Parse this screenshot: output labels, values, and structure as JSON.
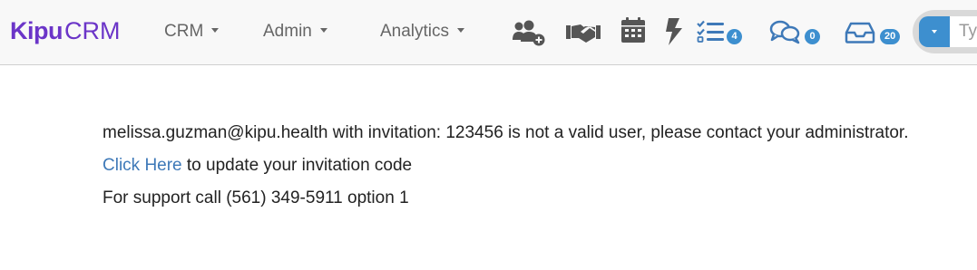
{
  "brand": {
    "part1": "Kipu",
    "part2": "CRM"
  },
  "nav": {
    "menus": [
      {
        "label": "CRM"
      },
      {
        "label": "Admin"
      },
      {
        "label": "Analytics"
      }
    ],
    "icons": [
      {
        "name": "add-user-icon"
      },
      {
        "name": "handshake-icon"
      },
      {
        "name": "calendar-icon"
      },
      {
        "name": "lightning-icon"
      },
      {
        "name": "task-list-icon",
        "badge": "4"
      },
      {
        "name": "comments-icon",
        "badge": "0"
      },
      {
        "name": "inbox-icon",
        "badge": "20"
      }
    ],
    "search": {
      "value": "Ty"
    }
  },
  "message": {
    "error_text": "melissa.guzman@kipu.health with invitation: 123456 is not a valid user, please contact your administrator.",
    "link_text": "Click Here",
    "link_suffix": " to update your invitation code",
    "support_text": "For support call (561) 349-5911 option 1"
  },
  "colors": {
    "brand": "#6b35c8",
    "accent": "#3d8fcf",
    "link": "#3e79b8",
    "nav_background": "#f8f8f8",
    "icon": "#555555"
  }
}
